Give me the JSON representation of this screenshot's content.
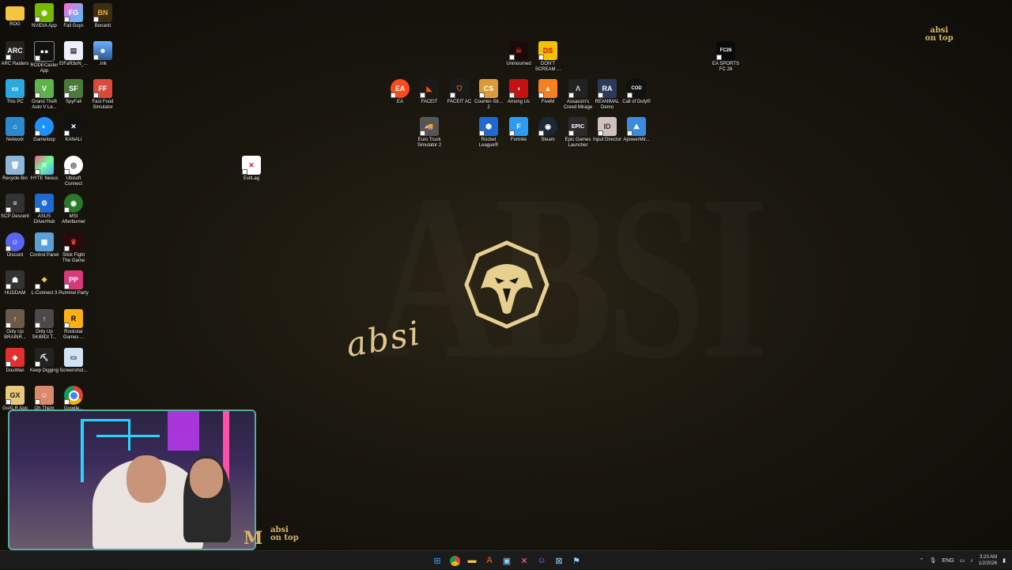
{
  "wallpaper": {
    "top_right_tag": [
      "absi",
      "on top"
    ],
    "bottom_tag": [
      "absi",
      "on top"
    ],
    "script_text": "absi",
    "accent": "#d7b66a"
  },
  "desktop_icons": {
    "rog": "ROG",
    "nvidia": "NVIDIA App",
    "fallguys": "Fall Guys",
    "bonanit": "Bonanit",
    "arc": "ARC Raiders",
    "rodecaster": "RODECaster App",
    "elfar": "ElFaR3oN_...",
    "ink": ".Ink",
    "thispc": "This PC",
    "gta": "Grand Theft Auto V Le...",
    "spyfall": "SpyFall",
    "fastfood": "Fast Food Simulator",
    "network": "Network",
    "gameloop": "Gameloop",
    "kanali": "KANALI",
    "recycle": "Recycle Bin",
    "hyte": "HYTE Nexus",
    "ubisoft": "Ubisoft Connect",
    "exitlag": "ExitLag",
    "scp": "SCP Descent",
    "asus": "ASUS DriverHub",
    "msi": "MSI Afterburner",
    "discord": "Discord",
    "control": "Control Panel",
    "stickfight": "Stick Fight The Game",
    "huddam": "HUDDAM",
    "lconnect": "L-Connect 3",
    "pummel": "Pummel Party",
    "onlyup1": "Only Up BRAINR...",
    "onlyup2": "Only Up SKIBIDI T...",
    "rockstar": "Rockstar Games ...",
    "douwan": "DouWan",
    "keepdigging": "Keep Digging",
    "screenshot": "Screenshot...",
    "goxlr": "GoXLR App",
    "row9b": "Oh Them Vo...",
    "chrome": "Google...",
    "unmourned": "Unmourned",
    "dontscream": "DON'T SCREAM ...",
    "easports": "EA SPORTS FC 26",
    "ea": "EA",
    "faceit": "FACEIT",
    "faceitac": "FACEIT AC",
    "counter": "Counter-Str... 2",
    "amongus": "Among Us",
    "fivem": "FiveM",
    "assassin": "Assassin's Creed Mirage",
    "reanimal": "REANIMAL Demo",
    "cod": "Call of Duty®",
    "eurotruck": "Euro Truck Simulator 2",
    "rocket": "Rocket League®",
    "fortnite": "Fortnite",
    "steam": "Steam",
    "epic": "Epic Games Launcher",
    "inputdirector": "Input Director",
    "apower": "ApowerMir..."
  },
  "taskbar": {
    "language": "ENG",
    "time": "3:20 AM",
    "date": "1/2/2026"
  }
}
